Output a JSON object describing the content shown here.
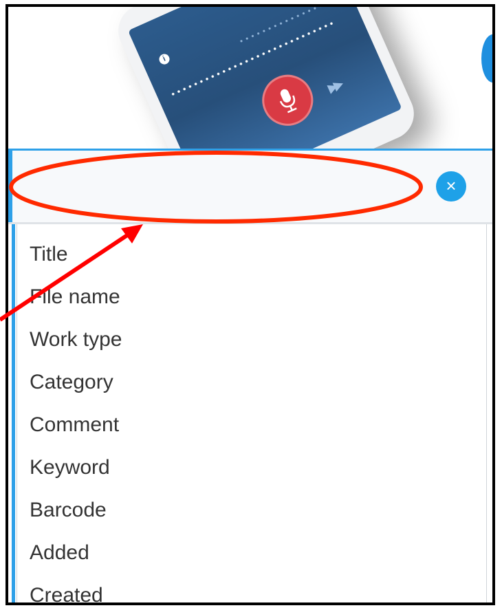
{
  "search": {
    "value": "",
    "placeholder": ""
  },
  "clear_icon": "close-icon",
  "clear_glyph": "×",
  "options": [
    "Title",
    "File name",
    "Work type",
    "Category",
    "Comment",
    "Keyword",
    "Barcode",
    "Added",
    "Created"
  ],
  "colors": {
    "accent": "#2ea0e8",
    "clear_button": "#1ea1e8",
    "annotation": "#ff2a00",
    "mic": "#d93a44"
  }
}
